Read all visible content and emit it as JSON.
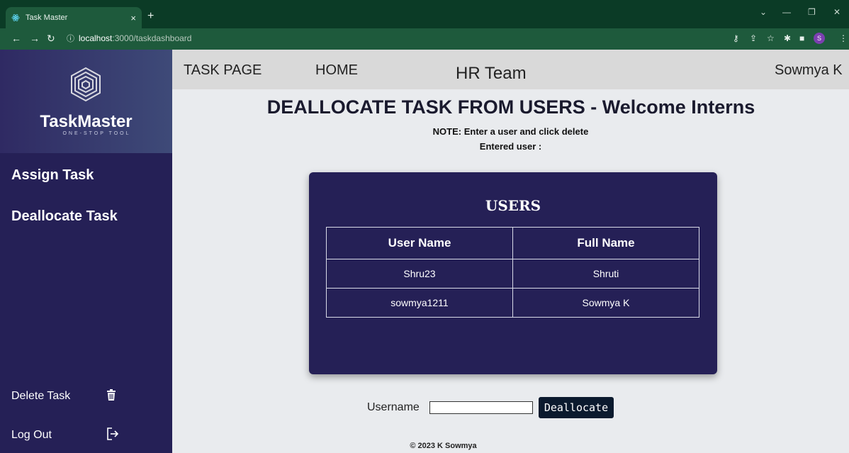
{
  "browser": {
    "tab_title": "Task Master",
    "tab_close": "×",
    "new_tab": "+",
    "url_host": "localhost",
    "url_path": ":3000/taskdashboard",
    "profile_initial": "S"
  },
  "sidebar": {
    "brand_name": "TaskMaster",
    "tagline": "ONE-STOP TOOL",
    "items": [
      {
        "label": "Assign Task"
      },
      {
        "label": "Deallocate Task"
      }
    ],
    "bottom_items": [
      {
        "label": "Delete Task",
        "icon": "trash-icon"
      },
      {
        "label": "Log Out",
        "icon": "logout-icon"
      }
    ]
  },
  "topnav": {
    "task_page": "TASK PAGE",
    "home": "HOME",
    "team": "HR Team",
    "user": "Sowmya K"
  },
  "main": {
    "heading": "DEALLOCATE TASK FROM USERS - Welcome Interns",
    "note": "NOTE: Enter a user and click delete",
    "entered_user": "Entered user :"
  },
  "users_card": {
    "title": "USERS",
    "columns": [
      "User Name",
      "Full Name"
    ],
    "rows": [
      [
        "Shru23",
        "Shruti"
      ],
      [
        "sowmya1211",
        "Sowmya K"
      ]
    ]
  },
  "form": {
    "label": "Username",
    "value": "",
    "button": "Deallocate"
  },
  "footer": "© 2023 K Sowmya",
  "colors": {
    "sidebar_bg": "#252056",
    "card_bg": "#252056",
    "topnav_bg": "#d9d9d9",
    "button_bg": "#0b1a2e"
  }
}
